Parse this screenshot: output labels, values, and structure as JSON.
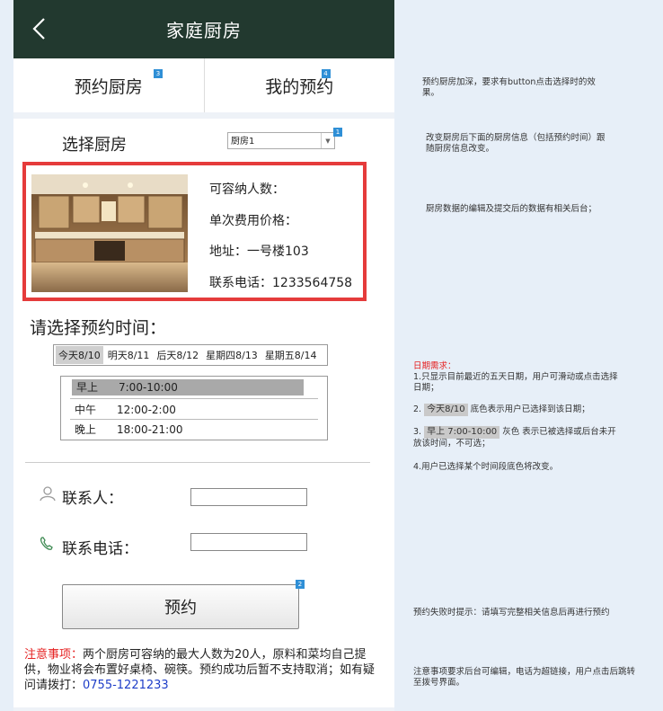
{
  "header": {
    "title": "家庭厨房"
  },
  "tabs": [
    {
      "label": "预约厨房",
      "badge": "3"
    },
    {
      "label": "我的预约",
      "badge": "4"
    }
  ],
  "kitchen_select": {
    "label": "选择厨房",
    "value": "厨房1",
    "badge": "1"
  },
  "kitchen_info": {
    "capacity": "可容纳人数：",
    "price": "单次费用价格：",
    "address": "地址：一号楼103",
    "phone": "联系电话：1233564758"
  },
  "time": {
    "title": "请选择预约时间：",
    "dates": [
      "今天8/10",
      "明天8/11",
      "后天8/12",
      "星期四8/13",
      "星期五8/14"
    ],
    "slots": [
      {
        "label": "早上",
        "time": "7:00-10:00"
      },
      {
        "label": "中午",
        "time": "12:00-2:00"
      },
      {
        "label": "晚上",
        "time": "18:00-21:00"
      }
    ]
  },
  "form": {
    "contact_label": "联系人：",
    "phone_label": "联系电话：",
    "contact_value": "",
    "phone_value": ""
  },
  "reserve_button": {
    "label": "预约",
    "badge": "2"
  },
  "notice": {
    "prefix": "注意事项：",
    "text": "两个厨房可容纳的最大人数为20人，原料和菜均自己提供，物业将会布置好桌椅、碗筷。预约成功后暂不支持取消；如有疑问请拨打：",
    "phone": "0755-1221233"
  },
  "notes": {
    "n1": "预约厨房加深，要求有button点击选择时的效果。",
    "n2": "改变厨房后下面的厨房信息（包括预约时间）跟随厨房信息改变。",
    "n3": "厨房数据的编辑及提交后的数据有相关后台；",
    "req_title": "日期需求：",
    "req_1": "1.只显示目前最近的五天日期，用户可滑动或点击选择日期；",
    "req_2_prefix": "2.",
    "req_2_chip": "今天8/10",
    "req_2_text": "底色表示用户已选择到该日期；",
    "req_3_prefix": "3.",
    "req_3_chip": "早上  7:00-10:00",
    "req_3_text": "灰色 表示已被选择或后台未开放该时间，不可选；",
    "req_4": "4.用户已选择某个时间段底色将改变。",
    "n_fail": "预约失败时提示：请填写完整相关信息后再进行预约",
    "n_notice": "注意事项要求后台可编辑，电话为超链接，用户点击后跳转至拨号界面。"
  }
}
